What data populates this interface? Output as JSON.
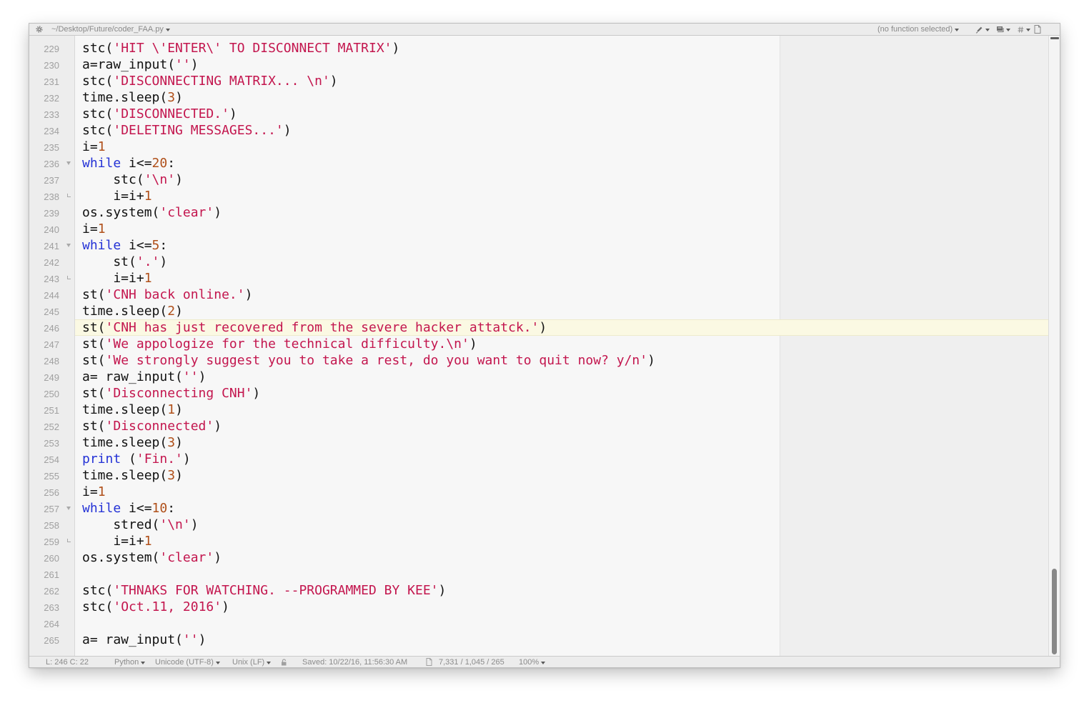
{
  "window": {
    "path": "~/Desktop/Future/coder_FAA.py",
    "function_menu": "(no function selected)",
    "icons": [
      "settings-gear-icon",
      "marker-icon",
      "text-options-icon",
      "hash-icon",
      "document-icon"
    ]
  },
  "syntax_colors": {
    "plain": "#111111",
    "string": "#c3164e",
    "number": "#b0501a",
    "keyword": "#2432d6"
  },
  "editor": {
    "current_line": 246,
    "lines": [
      {
        "n": 229,
        "tokens": [
          {
            "v": "stc("
          },
          {
            "v": "'HIT \\'ENTER\\' TO DISCONNECT MATRIX'",
            "color": "#c3164e"
          },
          {
            "v": ")"
          }
        ]
      },
      {
        "n": 230,
        "tokens": [
          {
            "v": "a=raw_input("
          },
          {
            "v": "''",
            "color": "#c3164e"
          },
          {
            "v": ")"
          }
        ]
      },
      {
        "n": 231,
        "tokens": [
          {
            "v": "stc("
          },
          {
            "v": "'DISCONNECTING MATRIX... \\n'",
            "color": "#c3164e"
          },
          {
            "v": ")"
          }
        ]
      },
      {
        "n": 232,
        "tokens": [
          {
            "v": "time.sleep("
          },
          {
            "v": "3",
            "color": "#b0501a"
          },
          {
            "v": ")"
          }
        ]
      },
      {
        "n": 233,
        "tokens": [
          {
            "v": "stc("
          },
          {
            "v": "'DISCONNECTED.'",
            "color": "#c3164e"
          },
          {
            "v": ")"
          }
        ]
      },
      {
        "n": 234,
        "tokens": [
          {
            "v": "stc("
          },
          {
            "v": "'DELETING MESSAGES...'",
            "color": "#c3164e"
          },
          {
            "v": ")"
          }
        ]
      },
      {
        "n": 235,
        "tokens": [
          {
            "v": "i="
          },
          {
            "v": "1",
            "color": "#b0501a"
          }
        ]
      },
      {
        "n": 236,
        "fold": "fold-open-icon",
        "tokens": [
          {
            "v": "while",
            "color": "#2432d6"
          },
          {
            "v": " i<="
          },
          {
            "v": "20",
            "color": "#b0501a"
          },
          {
            "v": ":"
          }
        ]
      },
      {
        "n": 237,
        "tokens": [
          {
            "v": "    stc("
          },
          {
            "v": "'\\n'",
            "color": "#c3164e"
          },
          {
            "v": ")"
          }
        ]
      },
      {
        "n": 238,
        "fold": "fold-end-icon",
        "tokens": [
          {
            "v": "    i=i+"
          },
          {
            "v": "1",
            "color": "#b0501a"
          }
        ]
      },
      {
        "n": 239,
        "tokens": [
          {
            "v": "os.system("
          },
          {
            "v": "'clear'",
            "color": "#c3164e"
          },
          {
            "v": ")"
          }
        ]
      },
      {
        "n": 240,
        "tokens": [
          {
            "v": "i="
          },
          {
            "v": "1",
            "color": "#b0501a"
          }
        ]
      },
      {
        "n": 241,
        "fold": "fold-open-icon",
        "tokens": [
          {
            "v": "while",
            "color": "#2432d6"
          },
          {
            "v": " i<="
          },
          {
            "v": "5",
            "color": "#b0501a"
          },
          {
            "v": ":"
          }
        ]
      },
      {
        "n": 242,
        "tokens": [
          {
            "v": "    st("
          },
          {
            "v": "'.'",
            "color": "#c3164e"
          },
          {
            "v": ")"
          }
        ]
      },
      {
        "n": 243,
        "fold": "fold-end-icon",
        "tokens": [
          {
            "v": "    i=i+"
          },
          {
            "v": "1",
            "color": "#b0501a"
          }
        ]
      },
      {
        "n": 244,
        "tokens": [
          {
            "v": "st("
          },
          {
            "v": "'CNH back online.'",
            "color": "#c3164e"
          },
          {
            "v": ")"
          }
        ]
      },
      {
        "n": 245,
        "tokens": [
          {
            "v": "time.sleep("
          },
          {
            "v": "2",
            "color": "#b0501a"
          },
          {
            "v": ")"
          }
        ]
      },
      {
        "n": 246,
        "tokens": [
          {
            "v": "st("
          },
          {
            "v": "'CNH has just recovered from the severe hacker attatck.'",
            "color": "#c3164e"
          },
          {
            "v": ")"
          }
        ]
      },
      {
        "n": 247,
        "tokens": [
          {
            "v": "st("
          },
          {
            "v": "'We appologize for the technical difficulty.\\n'",
            "color": "#c3164e"
          },
          {
            "v": ")"
          }
        ]
      },
      {
        "n": 248,
        "tokens": [
          {
            "v": "st("
          },
          {
            "v": "'We strongly suggest you to take a rest, do you want to quit now? y/n'",
            "color": "#c3164e"
          },
          {
            "v": ")"
          }
        ]
      },
      {
        "n": 249,
        "tokens": [
          {
            "v": "a= raw_input("
          },
          {
            "v": "''",
            "color": "#c3164e"
          },
          {
            "v": ")"
          }
        ]
      },
      {
        "n": 250,
        "tokens": [
          {
            "v": "st("
          },
          {
            "v": "'Disconnecting CNH'",
            "color": "#c3164e"
          },
          {
            "v": ")"
          }
        ]
      },
      {
        "n": 251,
        "tokens": [
          {
            "v": "time.sleep("
          },
          {
            "v": "1",
            "color": "#b0501a"
          },
          {
            "v": ")"
          }
        ]
      },
      {
        "n": 252,
        "tokens": [
          {
            "v": "st("
          },
          {
            "v": "'Disconnected'",
            "color": "#c3164e"
          },
          {
            "v": ")"
          }
        ]
      },
      {
        "n": 253,
        "tokens": [
          {
            "v": "time.sleep("
          },
          {
            "v": "3",
            "color": "#b0501a"
          },
          {
            "v": ")"
          }
        ]
      },
      {
        "n": 254,
        "tokens": [
          {
            "v": "print",
            "color": "#2432d6"
          },
          {
            "v": " ("
          },
          {
            "v": "'Fin.'",
            "color": "#c3164e"
          },
          {
            "v": ")"
          }
        ]
      },
      {
        "n": 255,
        "tokens": [
          {
            "v": "time.sleep("
          },
          {
            "v": "3",
            "color": "#b0501a"
          },
          {
            "v": ")"
          }
        ]
      },
      {
        "n": 256,
        "tokens": [
          {
            "v": "i="
          },
          {
            "v": "1",
            "color": "#b0501a"
          }
        ]
      },
      {
        "n": 257,
        "fold": "fold-open-icon",
        "tokens": [
          {
            "v": "while",
            "color": "#2432d6"
          },
          {
            "v": " i<="
          },
          {
            "v": "10",
            "color": "#b0501a"
          },
          {
            "v": ":"
          }
        ]
      },
      {
        "n": 258,
        "tokens": [
          {
            "v": "    stred("
          },
          {
            "v": "'\\n'",
            "color": "#c3164e"
          },
          {
            "v": ")"
          }
        ]
      },
      {
        "n": 259,
        "fold": "fold-end-icon",
        "tokens": [
          {
            "v": "    i=i+"
          },
          {
            "v": "1",
            "color": "#b0501a"
          }
        ]
      },
      {
        "n": 260,
        "tokens": [
          {
            "v": "os.system("
          },
          {
            "v": "'clear'",
            "color": "#c3164e"
          },
          {
            "v": ")"
          }
        ]
      },
      {
        "n": 261,
        "tokens": []
      },
      {
        "n": 262,
        "tokens": [
          {
            "v": "stc("
          },
          {
            "v": "'THNAKS FOR WATCHING. --PROGRAMMED BY KEE'",
            "color": "#c3164e"
          },
          {
            "v": ")"
          }
        ]
      },
      {
        "n": 263,
        "tokens": [
          {
            "v": "stc("
          },
          {
            "v": "'Oct.11, 2016'",
            "color": "#c3164e"
          },
          {
            "v": ")"
          }
        ]
      },
      {
        "n": 264,
        "tokens": []
      },
      {
        "n": 265,
        "tokens": [
          {
            "v": "a= raw_input("
          },
          {
            "v": "''",
            "color": "#c3164e"
          },
          {
            "v": ")"
          }
        ]
      }
    ]
  },
  "status": {
    "position": "L: 246 C: 22",
    "language": "Python",
    "encoding": "Unicode (UTF-8)",
    "line_endings": "Unix (LF)",
    "saved": "Saved: 10/22/16, 11:56:30 AM",
    "counts": "7,331 / 1,045 / 265",
    "zoom": "100%"
  },
  "scroll": {
    "position": 1.0,
    "visible_fraction": 0.14
  }
}
